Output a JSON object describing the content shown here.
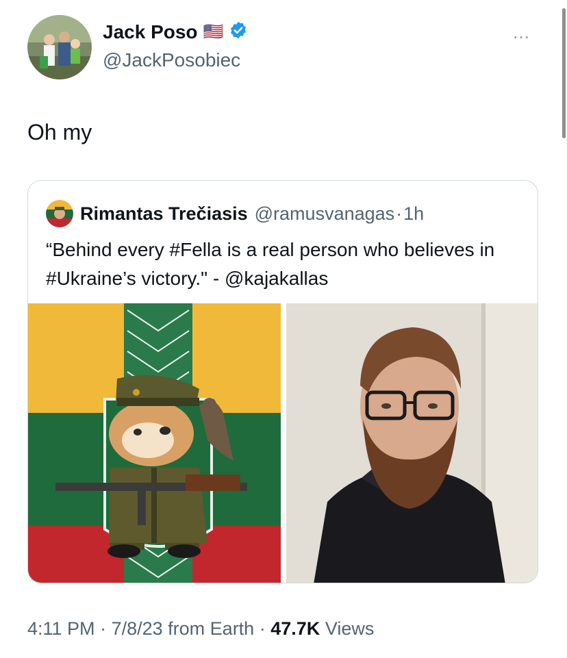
{
  "author": {
    "name": "Jack Poso",
    "flag": "🇺🇸",
    "handle": "@JackPosobiec",
    "verified": true
  },
  "tweet": {
    "text": "Oh my",
    "more_icon": "…"
  },
  "quoted": {
    "name": "Rimantas Trečiasis",
    "handle": "@ramusvanagas",
    "sep": "·",
    "time": "1h",
    "text": "“Behind every #Fella is a real person who believes in #Ukraine’s victory.\" - @kajakallas"
  },
  "meta": {
    "time": "4:11 PM",
    "sep1": "·",
    "date": "7/8/23 from Earth",
    "sep2": "·",
    "views_count": "47.7K",
    "views_label": "Views"
  },
  "colors": {
    "verified": "#1d9bf0",
    "flag_yellow": "#f1b93a",
    "flag_green": "#1f6b3c",
    "flag_red": "#c1272d"
  }
}
